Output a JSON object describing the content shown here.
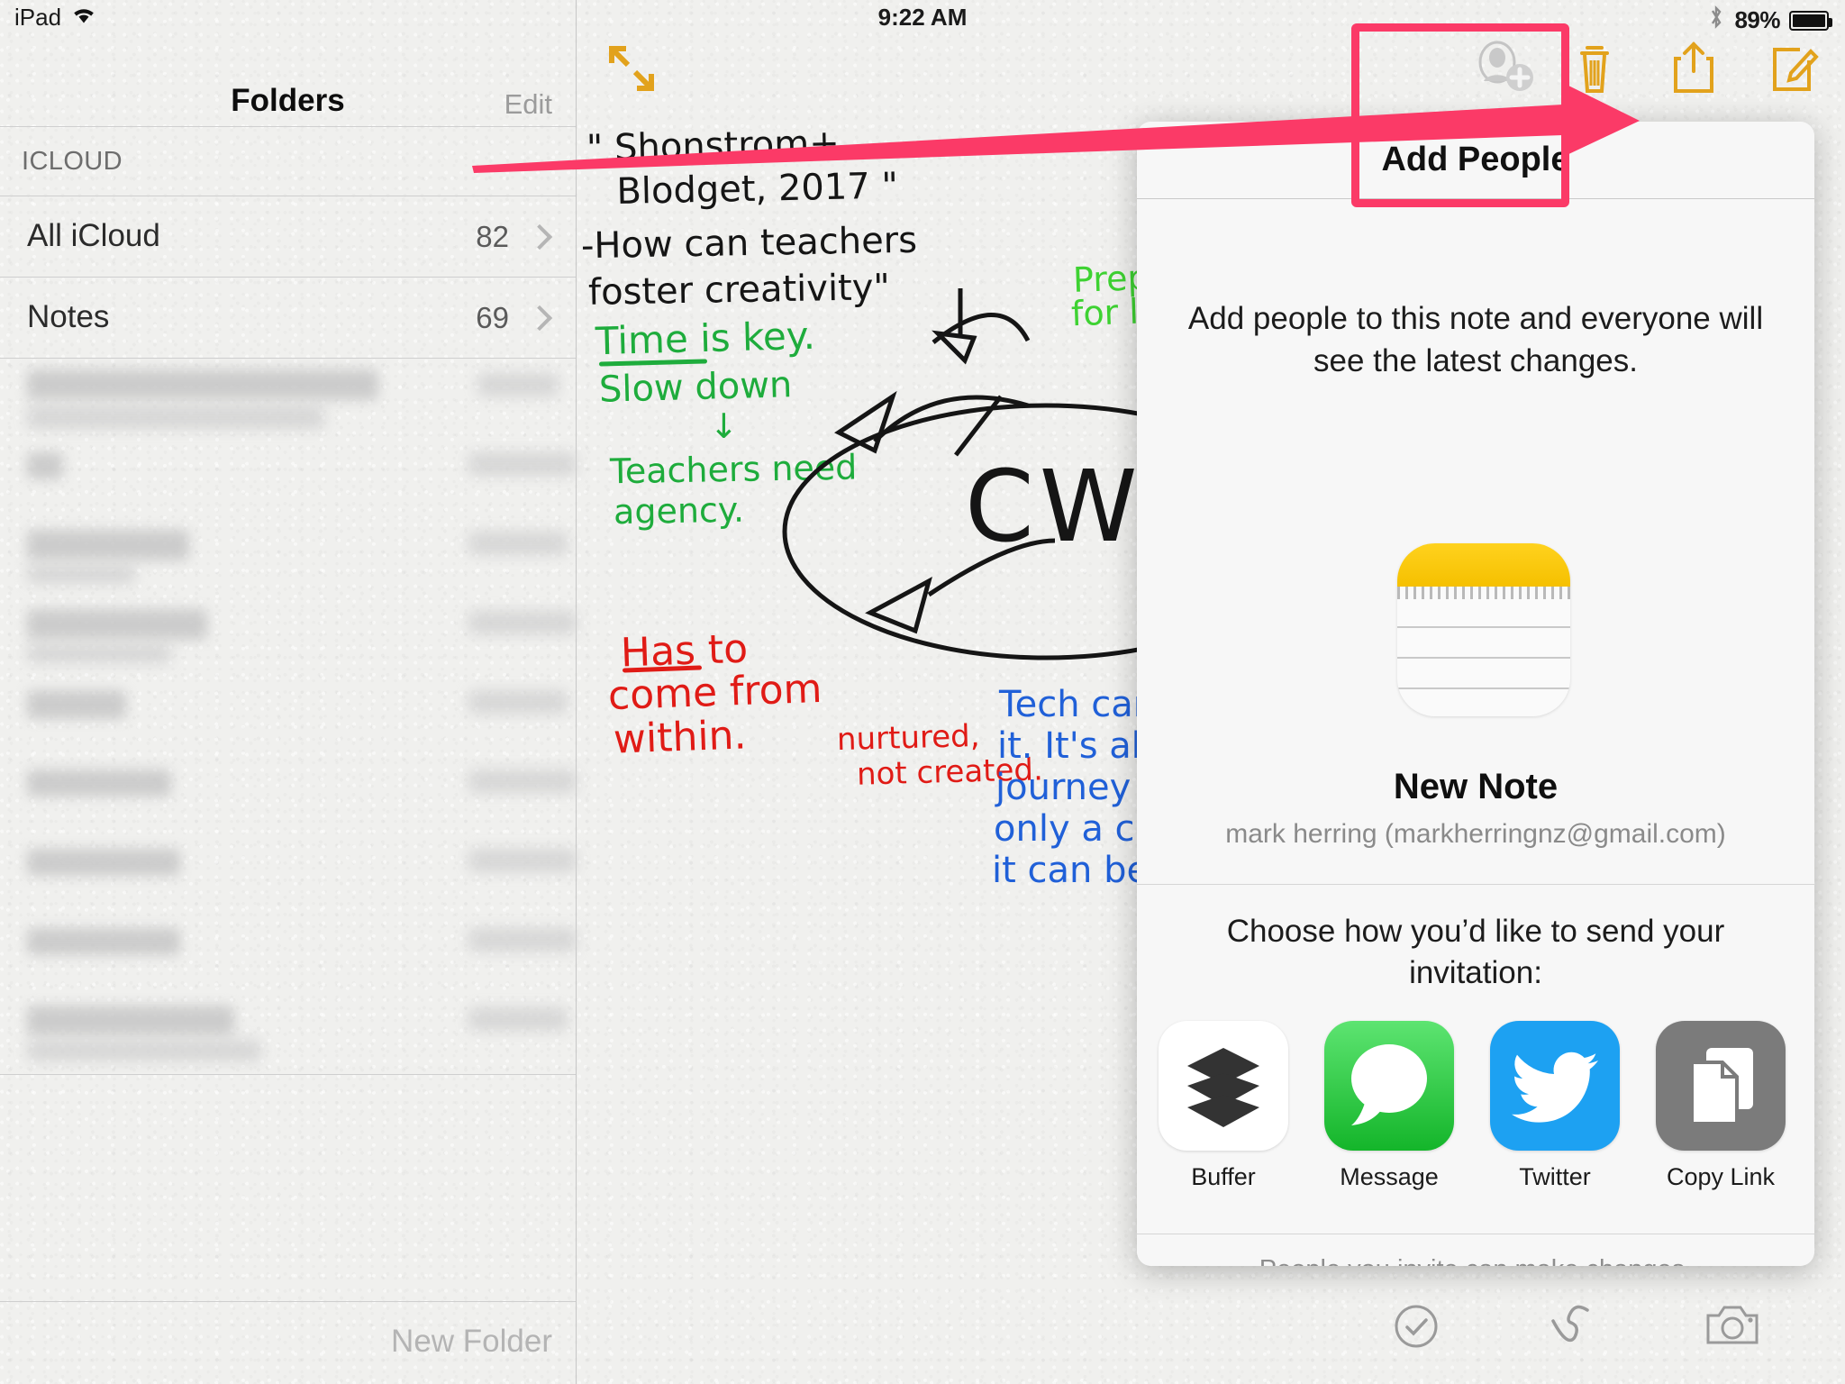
{
  "status_bar": {
    "device_label": "iPad",
    "wifi_icon": "wifi-icon",
    "time": "9:22 AM",
    "bluetooth_icon": "bluetooth-icon",
    "battery_percent": "89%",
    "battery_icon": "battery-icon"
  },
  "sidebar": {
    "title": "Folders",
    "edit_label": "Edit",
    "section_header": "ICLOUD",
    "folders": [
      {
        "name": "All iCloud",
        "count": "82"
      },
      {
        "name": "Notes",
        "count": "69"
      }
    ],
    "new_folder_label": "New Folder"
  },
  "note_toolbar": {
    "expand_icon": "expand-arrows-icon",
    "add_people_icon": "add-person-icon",
    "delete_icon": "trash-icon",
    "share_icon": "share-icon",
    "compose_icon": "compose-icon",
    "accent_color": "#e2a21c"
  },
  "note_bottom_toolbar": {
    "checklist_icon": "checkmark-circle-icon",
    "markup_icon": "squiggle-markup-icon",
    "camera_icon": "camera-icon"
  },
  "note_content": {
    "black_lines": [
      "\" Shonstrom+",
      "  Blodget, 2017 \"",
      "-How can teachers",
      "foster creativity\""
    ],
    "green_lines": [
      "Time is key.",
      "Slow down",
      "      ↓",
      " Teachers need",
      " agency."
    ],
    "green_right_lines": [
      "Prepa",
      "for l"
    ],
    "red_lines": [
      "Has to",
      "come from",
      "within."
    ],
    "red_note_lines": [
      "nurtured,",
      "not created."
    ],
    "blue_lines": [
      "Tech can",
      "it. It's ab",
      "journey + i",
      "only a clic",
      "it can be"
    ],
    "center_word": "CWRIT"
  },
  "popover": {
    "title": "Add People",
    "description": "Add people to this note and everyone will see the latest changes.",
    "note_icon": "notes-app-icon",
    "note_title": "New Note",
    "note_owner": "mark herring (markherringnz@gmail.com)",
    "choose_prompt": "Choose how you’d like to send your invitation:",
    "share_targets": [
      {
        "label": "Buffer",
        "icon": "buffer-icon",
        "color": "#ffffff"
      },
      {
        "label": "Message",
        "icon": "messages-icon",
        "color": "#4cd964"
      },
      {
        "label": "Twitter",
        "icon": "twitter-icon",
        "color": "#1da1f2"
      },
      {
        "label": "Copy Link",
        "icon": "copy-link-icon",
        "color": "#7b7b7b"
      },
      {
        "label": "",
        "icon": "facebook-icon",
        "color": "#3b5998"
      }
    ],
    "footer": "People you invite can make changes."
  },
  "annotations": {
    "highlight_color": "#fb3a67",
    "arrow_icon": "pointer-arrow-annotation",
    "highlight_box_icon": "highlight-box-annotation"
  }
}
